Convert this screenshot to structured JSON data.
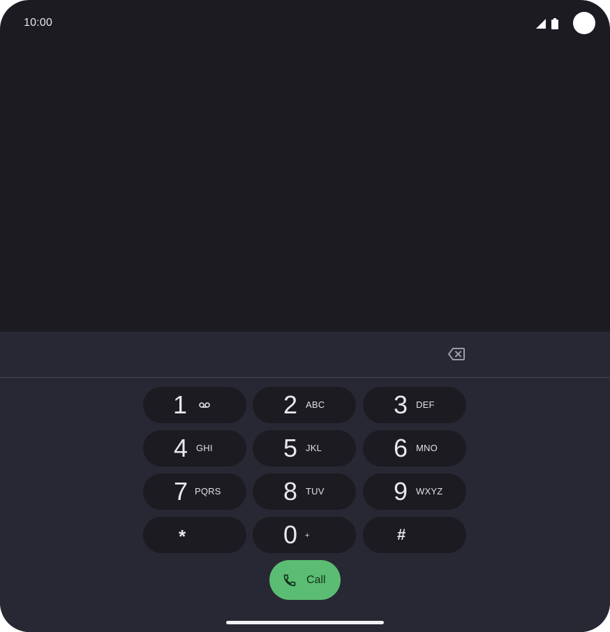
{
  "status_bar": {
    "time": "10:00",
    "icons": [
      "signal-icon",
      "battery-icon"
    ]
  },
  "dialer": {
    "digits": "",
    "backspace_icon": "backspace-icon",
    "keys": [
      {
        "digit": "1",
        "letters": "",
        "icon": "voicemail-icon"
      },
      {
        "digit": "2",
        "letters": "ABC"
      },
      {
        "digit": "3",
        "letters": "DEF"
      },
      {
        "digit": "4",
        "letters": "GHI"
      },
      {
        "digit": "5",
        "letters": "JKL"
      },
      {
        "digit": "6",
        "letters": "MNO"
      },
      {
        "digit": "7",
        "letters": "PQRS"
      },
      {
        "digit": "8",
        "letters": "TUV"
      },
      {
        "digit": "9",
        "letters": "WXYZ"
      },
      {
        "digit": "*",
        "letters": ""
      },
      {
        "digit": "0",
        "letters": "+"
      },
      {
        "digit": "#",
        "letters": ""
      }
    ],
    "call_label": "Call",
    "call_icon": "phone-icon"
  },
  "colors": {
    "screen_background": "#1c1b22",
    "dialpad_background": "#272833",
    "key_background": "#1c1b22",
    "call_button": "#5bbd73",
    "text": "#e8e8ee"
  }
}
